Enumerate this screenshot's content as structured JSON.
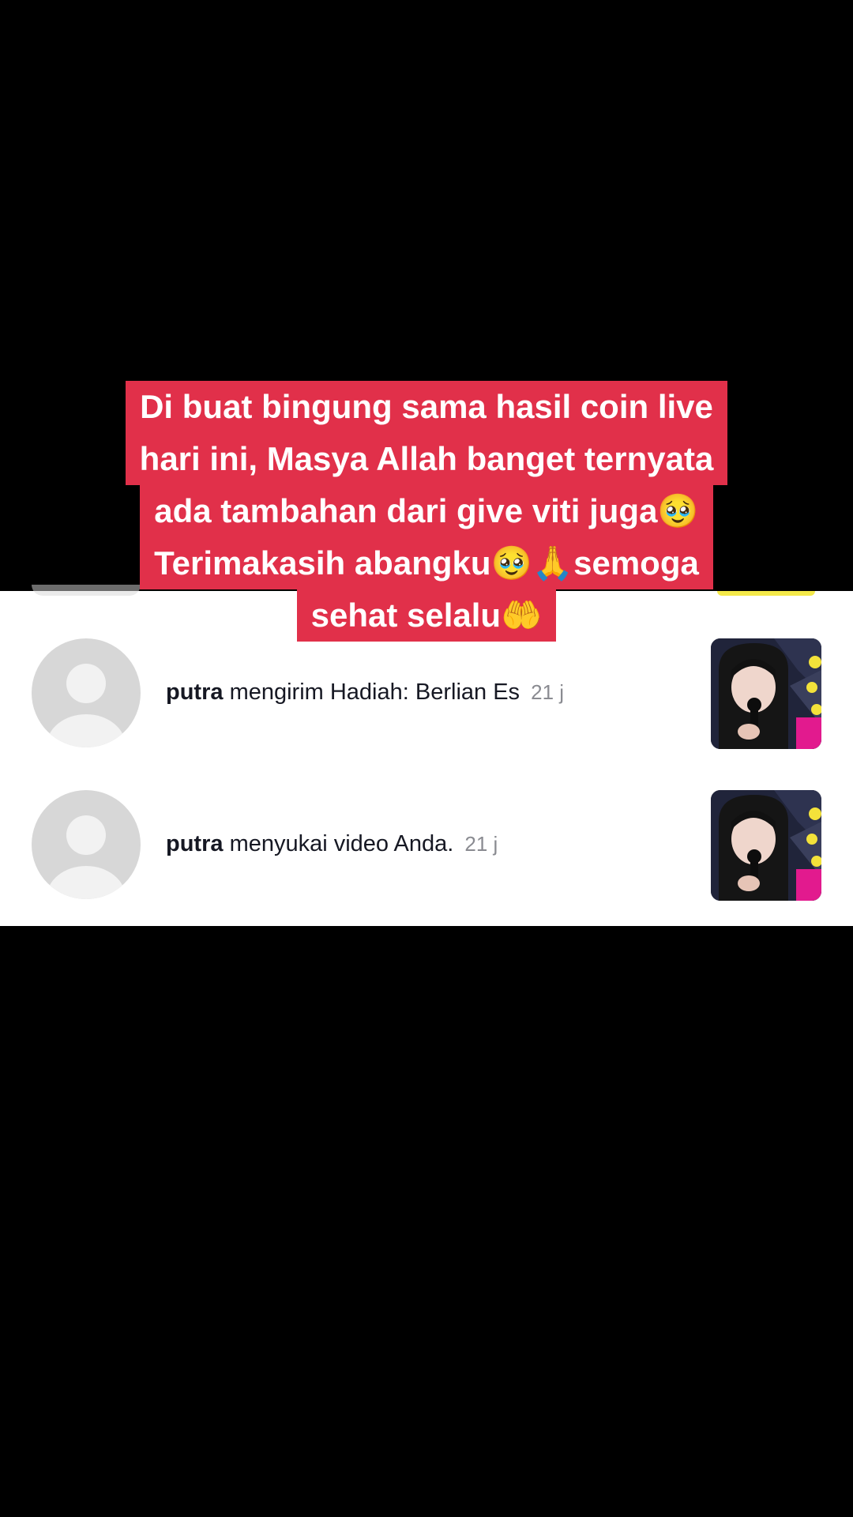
{
  "caption": {
    "lines": [
      "Di buat bingung sama hasil coin live",
      "hari ini, Masya Allah banget ternyata",
      "ada tambahan dari give viti juga🥹",
      "Terimakasih abangku🥹🙏semoga",
      "sehat selalu🤲"
    ]
  },
  "notifications": [
    {
      "username": "putra",
      "action": "mengirim Hadiah: Berlian Es",
      "time": "21 j",
      "avatar_icon": "default-user-avatar",
      "thumbnail": "video-thumbnail"
    },
    {
      "username": "putra",
      "action": "menyukai video Anda.",
      "time": "21 j",
      "avatar_icon": "default-user-avatar",
      "thumbnail": "video-thumbnail"
    }
  ],
  "colors": {
    "caption_bg": "#e1304a",
    "panel_bg": "#ffffff",
    "background": "#000000",
    "timestamp": "#8a8b91"
  }
}
